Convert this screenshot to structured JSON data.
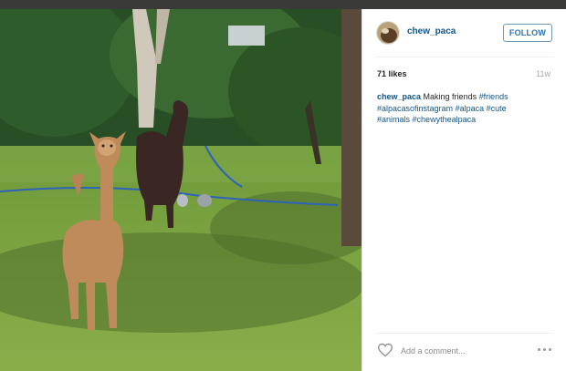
{
  "post": {
    "username": "chew_paca",
    "follow_label": "FOLLOW",
    "likes": "71 likes",
    "time_ago": "11w",
    "caption": {
      "user": "chew_paca",
      "text": "Making friends",
      "hashtags": [
        "#friends",
        "#alpacasofinstagram",
        "#alpaca",
        "#cute",
        "#animals",
        "#chewythealpaca"
      ]
    },
    "comment_placeholder": "Add a comment..."
  },
  "icons": {
    "like": "heart-icon",
    "more": "more-options-icon"
  },
  "colors": {
    "link": "#125688",
    "follow_border": "#6f97b6",
    "background": "#ffffff"
  }
}
